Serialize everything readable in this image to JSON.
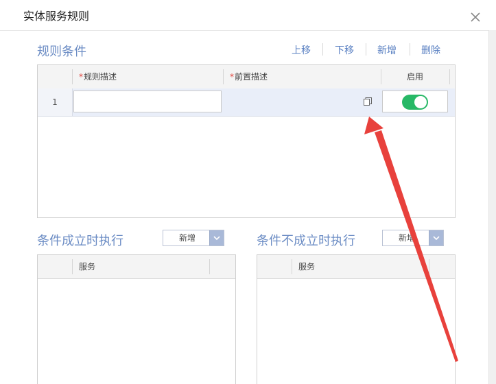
{
  "dialog": {
    "title": "实体服务规则"
  },
  "conditions": {
    "title": "规则条件",
    "toolbar": {
      "move_up": "上移",
      "move_down": "下移",
      "add": "新增",
      "delete": "删除"
    },
    "columns": {
      "rule_desc": "规则描述",
      "pre_desc": "前置描述",
      "enabled": "启用"
    },
    "required_mark": "*",
    "rows": [
      {
        "index": "1",
        "rule_desc": "",
        "enabled": true
      }
    ]
  },
  "true_branch": {
    "title": "条件成立时执行",
    "add_label": "新增",
    "columns": {
      "service": "服务"
    }
  },
  "false_branch": {
    "title": "条件不成立时执行",
    "add_label": "新增",
    "columns": {
      "service": "服务"
    }
  },
  "colors": {
    "accent": "#5a80c2",
    "toggle_on": "#27b866",
    "annotation_arrow": "#e8413c"
  }
}
